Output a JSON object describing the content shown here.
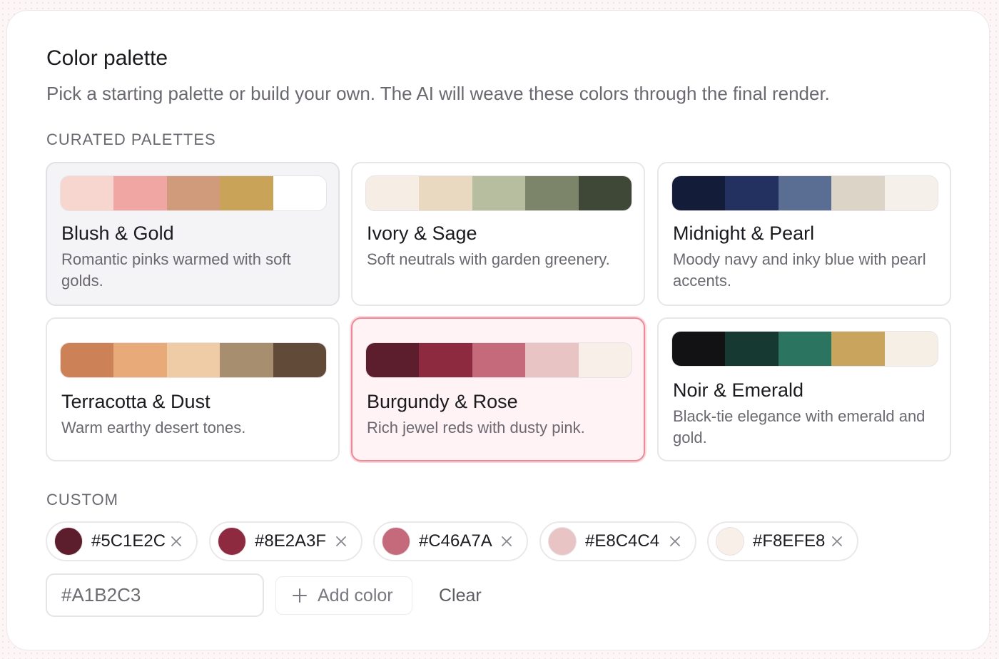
{
  "header": {
    "title": "Color palette",
    "subtitle": "Pick a starting palette or build your own. The AI will weave these colors through the final render."
  },
  "curated": {
    "label": "CURATED PALETTES",
    "palettes": [
      {
        "name": "Blush & Gold",
        "description": "Romantic pinks warmed with soft golds.",
        "colors": [
          "#F7D6D0",
          "#F0A6A2",
          "#D09B7A",
          "#C9A458",
          "#FFFFFF"
        ],
        "state": "hover"
      },
      {
        "name": "Ivory & Sage",
        "description": "Soft neutrals with garden greenery.",
        "colors": [
          "#F6EEE4",
          "#E8D9C0",
          "#B7BEA0",
          "#7C846A",
          "#3F4836"
        ],
        "state": "default"
      },
      {
        "name": "Midnight & Pearl",
        "description": "Moody navy and inky blue with pearl accents.",
        "colors": [
          "#131C38",
          "#223160",
          "#5A6E94",
          "#DDD4C8",
          "#F6F0EA"
        ],
        "state": "default"
      },
      {
        "name": "Terracotta & Dust",
        "description": "Warm earthy desert tones.",
        "colors": [
          "#CC8157",
          "#E9AA7A",
          "#EFCBA6",
          "#A68E6E",
          "#624A38"
        ],
        "state": "default"
      },
      {
        "name": "Burgundy & Rose",
        "description": "Rich jewel reds with dusty pink.",
        "colors": [
          "#5C1E2C",
          "#8E2A3F",
          "#C46A7A",
          "#E8C4C4",
          "#F8EFE8"
        ],
        "state": "selected"
      },
      {
        "name": "Noir & Emerald",
        "description": "Black-tie elegance with emerald and gold.",
        "colors": [
          "#121114",
          "#163A31",
          "#2A7460",
          "#C8A45C",
          "#F6EFE6"
        ],
        "state": "default"
      }
    ]
  },
  "custom": {
    "label": "CUSTOM",
    "colors": [
      "#5C1E2C",
      "#8E2A3F",
      "#C46A7A",
      "#E8C4C4",
      "#F8EFE8"
    ],
    "remove_icon": "close-icon",
    "input_placeholder": "#A1B2C3",
    "input_value": "",
    "add_label": "Add color",
    "add_icon": "plus-icon",
    "clear_label": "Clear"
  }
}
